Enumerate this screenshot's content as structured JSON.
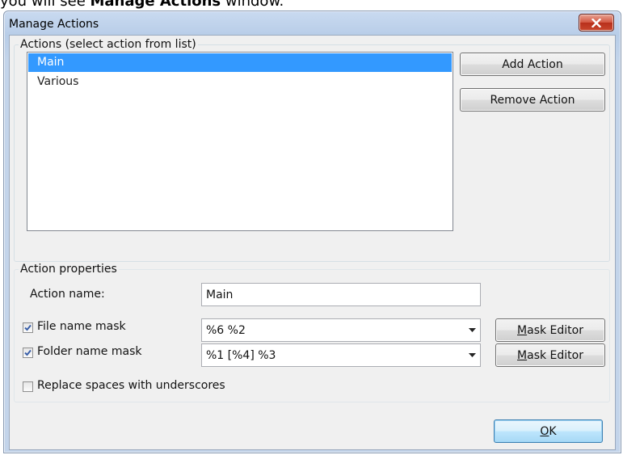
{
  "caption": {
    "prefix": "you will see ",
    "bold": "Manage Actions",
    "suffix": " window."
  },
  "window": {
    "title": "Manage Actions"
  },
  "actions_group": {
    "legend": "Actions (select action from list)",
    "items": [
      "Main",
      "Various"
    ],
    "selected_index": 0,
    "add_label": "Add Action",
    "remove_label": "Remove Action"
  },
  "properties_group": {
    "legend": "Action properties",
    "action_name_label": "Action name:",
    "action_name_value": "Main",
    "file_mask": {
      "label": "File name mask",
      "checked": true,
      "value": "%6 %2",
      "editor_mnemonic": "M",
      "editor_rest": "ask Editor"
    },
    "folder_mask": {
      "label": "Folder name mask",
      "checked": true,
      "value": "%1 [%4] %3",
      "editor_mnemonic": "M",
      "editor_rest": "ask Editor"
    },
    "replace_spaces": {
      "label": "Replace spaces with underscores",
      "checked": false
    }
  },
  "footer": {
    "ok_mnemonic": "O",
    "ok_rest": "K"
  },
  "colors": {
    "selection": "#3399ff",
    "close_button": "#c9472e"
  }
}
